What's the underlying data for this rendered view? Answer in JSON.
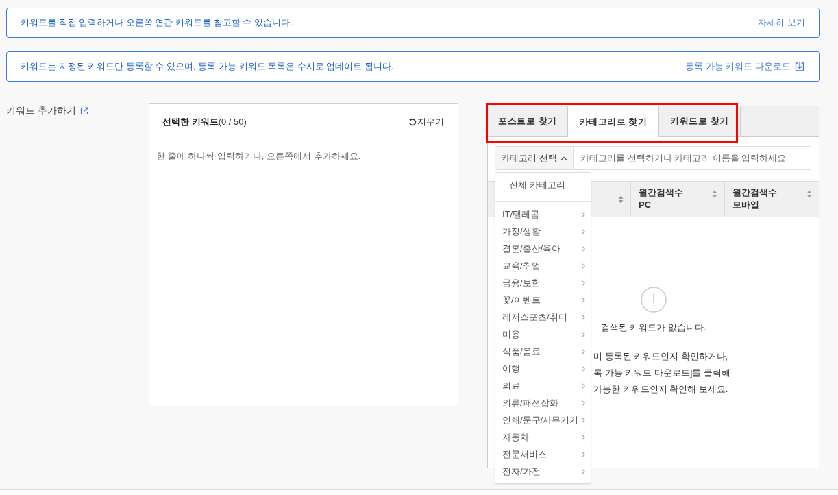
{
  "notices": [
    {
      "kind": "info",
      "text": "키워드를 직접 입력하거나 오른쪽 연관 키워드를 참고할 수 있습니다.",
      "link": "자세히 보기"
    },
    {
      "kind": "download",
      "text": "키워드는 지정된 키워드만 등록할 수 있으며, 등록 가능 키워드 목록은 수시로 업데이트 됩니다.",
      "link": "등록 가능 키워드 다운로드"
    }
  ],
  "add_keywords": {
    "label": "키워드 추가하기"
  },
  "selected_panel": {
    "title": "선택한 키워드",
    "count": "(0 / 50)",
    "clear_button": "지우기",
    "placeholder": "한 줄에 하나씩 입력하거나, 오른쪽에서 추가하세요."
  },
  "finder": {
    "tabs_highlighted": true,
    "tabs": [
      {
        "label": "포스트로 찾기",
        "selected": false
      },
      {
        "label": "카테고리로 찾기",
        "selected": true
      },
      {
        "label": "키워드로 찾기",
        "selected": false
      }
    ],
    "category_select": {
      "label": "카테고리 선택",
      "expanded": true,
      "menu": {
        "all": "전체 카테고리",
        "items": [
          {
            "label": "IT/텔레콤",
            "has_children": true
          },
          {
            "label": "가정/생활",
            "has_children": true
          },
          {
            "label": "결혼/출산/육아",
            "has_children": true
          },
          {
            "label": "교육/취업",
            "has_children": true
          },
          {
            "label": "금융/보험",
            "has_children": true
          },
          {
            "label": "꽃/이벤트",
            "has_children": true
          },
          {
            "label": "레저스포츠/취미",
            "has_children": true
          },
          {
            "label": "미용",
            "has_children": true
          },
          {
            "label": "식품/음료",
            "has_children": true
          },
          {
            "label": "여행",
            "has_children": true
          },
          {
            "label": "의료",
            "has_children": true
          },
          {
            "label": "의류/패션잡화",
            "has_children": true
          },
          {
            "label": "인쇄/문구/사무기기",
            "has_children": true
          },
          {
            "label": "자동차",
            "has_children": true
          },
          {
            "label": "전문서비스",
            "has_children": true
          },
          {
            "label": "전자/가전",
            "has_children": true
          }
        ]
      }
    },
    "search": {
      "placeholder": "카테고리를 선택하거나 카테고리 이름을 입력하세요"
    },
    "table": {
      "columns": [
        {
          "sortable": true
        },
        {
          "label": "월간검색수\nPC",
          "sortable": true
        },
        {
          "label": "월간검색수\n모바일",
          "sortable": true
        }
      ]
    },
    "empty_state": {
      "message": "검색된 키워드가 없습니다.",
      "hint": "미 등록된 키워드인지 확인하거나,\n록 가능 키워드 다운로드]를 클릭해\n가능한 키워드인지 확인해 보세요."
    }
  }
}
